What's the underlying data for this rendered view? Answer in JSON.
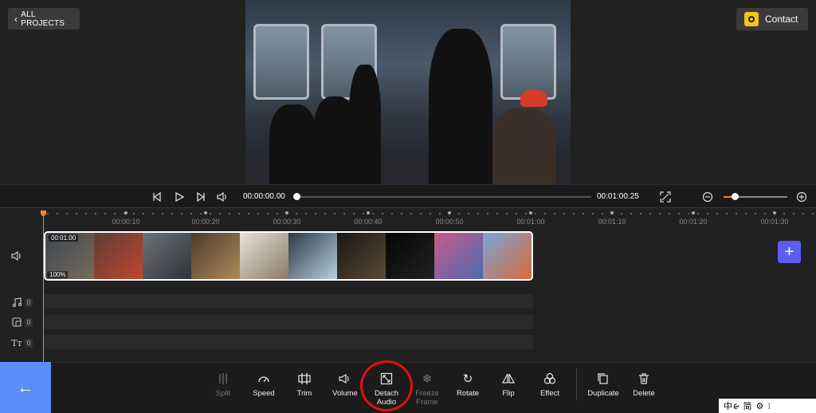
{
  "header": {
    "back_label": "ALL PROJECTS",
    "contact_label": "Contact"
  },
  "player": {
    "current_time": "00:00:00.00",
    "total_time": "00:01:00.25",
    "progress_fraction": 0.0
  },
  "ruler": {
    "labels": [
      "00:00:10",
      "00:00:20",
      "00:00:30",
      "00:00:40",
      "00:00:50",
      "00:01:00",
      "00:01:10",
      "00:01:20",
      "00:01:30"
    ]
  },
  "tracks": {
    "clip_duration": "00:01:00",
    "clip_volume": "100%",
    "audio_count": "0",
    "overlay_count": "0",
    "text_count": "0"
  },
  "toolbar": {
    "split": "Split",
    "speed": "Speed",
    "trim": "Trim",
    "volume": "Volume",
    "detach_audio": "Detach Audio",
    "freeze_frame": "Freeze Frame",
    "rotate": "Rotate",
    "flip": "Flip",
    "effect": "Effect",
    "duplicate": "Duplicate",
    "delete": "Delete"
  },
  "ime": {
    "text": "中ᰡ 简 ⚙ ⁝"
  },
  "colors": {
    "accent": "#f08a1c",
    "add_button": "#5b5cf0",
    "back_nav": "#5b8cf7",
    "highlight": "#e01010"
  }
}
